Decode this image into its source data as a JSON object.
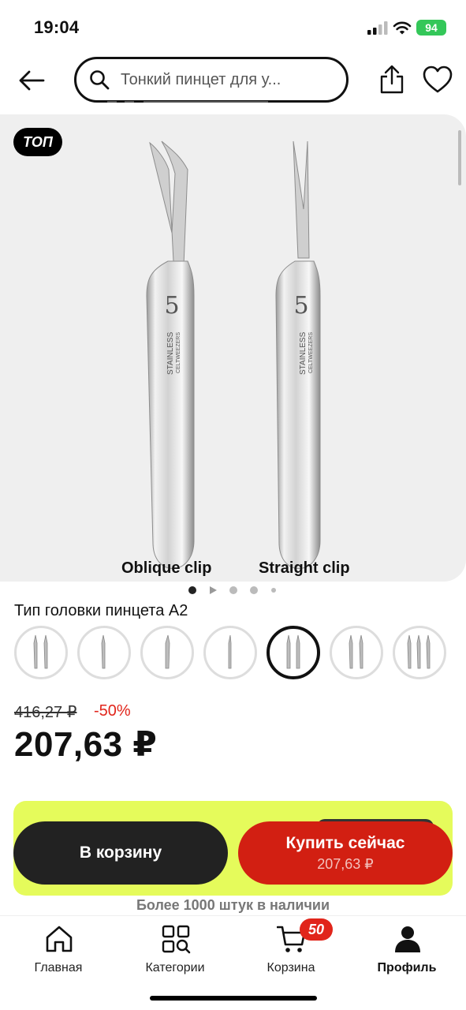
{
  "status_bar": {
    "time": "19:04",
    "battery": "94"
  },
  "header": {
    "search_text": "Тонкий пинцет для у...",
    "icons": {
      "back": "arrow-left-icon",
      "search": "search-icon",
      "share": "share-icon",
      "favorite": "heart-icon"
    }
  },
  "gallery": {
    "badge": "ТОП",
    "caption_left": "Oblique clip",
    "caption_right": "Straight clip",
    "tweezer_number": "5",
    "engraving_line1": "STAINLESS",
    "engraving_line2": "CELTWEEZERS",
    "pagination": {
      "count": 5,
      "active_index": 0
    }
  },
  "variants": {
    "title": "Тип головки пинцета A2",
    "count": 7,
    "selected_index": 4
  },
  "pricing": {
    "old_price": "416,27 ₽",
    "discount": "-50%",
    "price": "207,63 ₽"
  },
  "actions": {
    "add_to_cart": "В корзину",
    "buy_now": "Купить сейчас",
    "buy_now_price": "207,63 ₽",
    "stock": "Более 1000 штук в наличии"
  },
  "tabbar": {
    "items": [
      {
        "label": "Главная",
        "icon": "home-icon"
      },
      {
        "label": "Категории",
        "icon": "categories-icon"
      },
      {
        "label": "Корзина",
        "icon": "cart-icon"
      },
      {
        "label": "Профиль",
        "icon": "profile-icon"
      }
    ],
    "cart_badge": "50",
    "active_index": 3
  },
  "colors": {
    "accent_red": "#d21f12",
    "promo_yellow": "#e5fb5b",
    "battery_green": "#34c759"
  }
}
